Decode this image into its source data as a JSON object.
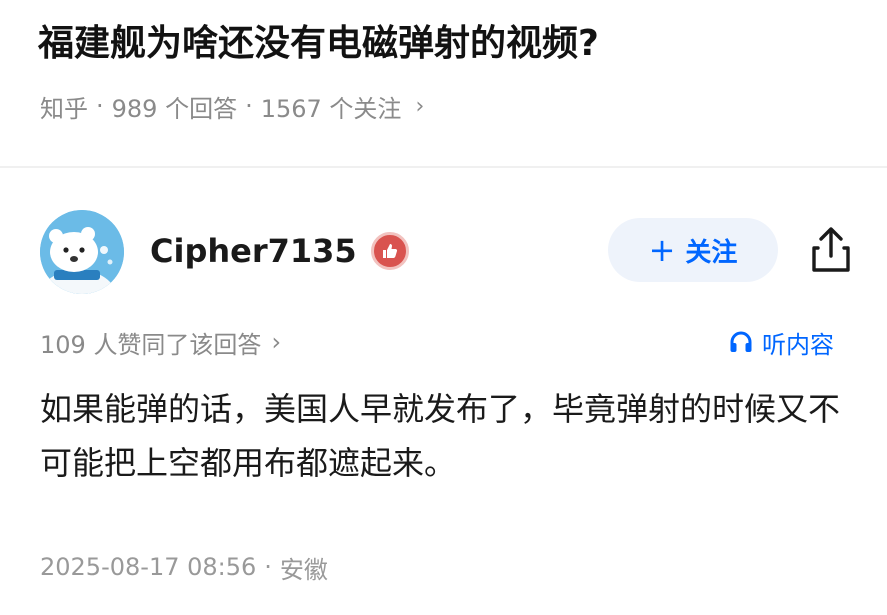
{
  "question": {
    "title": "福建舰为啥还没有电磁弹射的视频?",
    "source": "知乎",
    "separator": "·",
    "answers": "989 个回答",
    "followers": "1567 个关注",
    "chevron": "›"
  },
  "answer": {
    "author": {
      "name": "Cipher7135",
      "avatar_icon": "polar-bear-avatar",
      "badge_icon": "thumbs-up-badge-icon"
    },
    "follow_button": {
      "plus": "+",
      "label": "关注"
    },
    "share_icon": "share-icon",
    "likes_text": "109 人赞同了该回答",
    "likes_chevron": "›",
    "listen": {
      "icon": "headphones-icon",
      "label": "听内容"
    },
    "content": "如果能弹的话，美国人早就发布了，毕竟弹射的时候又不可能把上空都用布都遮起来。",
    "timestamp": "2025-08-17 08:56",
    "location": "安徽",
    "separator": "·"
  },
  "colors": {
    "accent": "#0066ff",
    "follow_bg": "#eef3fb",
    "muted": "#8a8a8a",
    "badge": "#d9534f"
  }
}
